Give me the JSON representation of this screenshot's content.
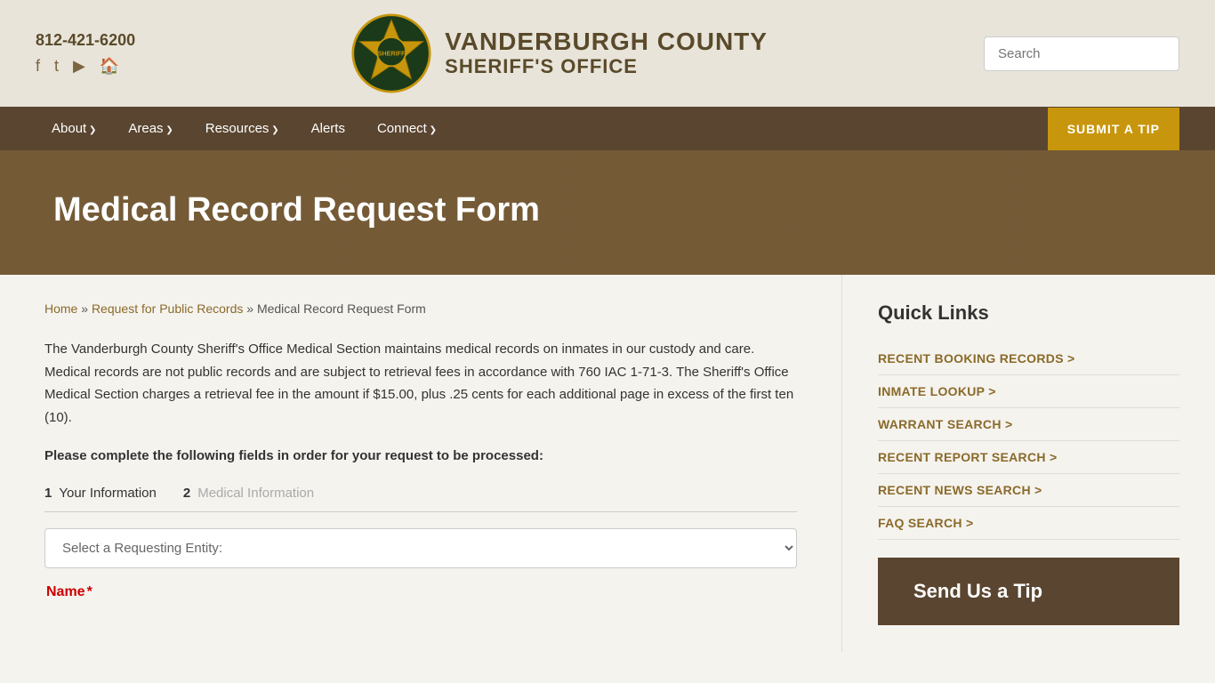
{
  "header": {
    "phone": "812-421-6200",
    "logo_title": "VANDERBURGH COUNTY",
    "logo_subtitle": "SHERIFF'S OFFICE",
    "search_placeholder": "Search"
  },
  "nav": {
    "items": [
      {
        "label": "About",
        "has_arrow": true
      },
      {
        "label": "Areas",
        "has_arrow": true
      },
      {
        "label": "Resources",
        "has_arrow": true
      },
      {
        "label": "Alerts",
        "has_arrow": false
      },
      {
        "label": "Connect",
        "has_arrow": true
      }
    ],
    "cta_label": "SUBMIT A TIP"
  },
  "hero": {
    "title": "Medical Record Request Form"
  },
  "breadcrumb": {
    "home": "Home",
    "separator1": " » ",
    "parent": "Request for Public Records",
    "separator2": " » ",
    "current": "Medical Record Request Form"
  },
  "content": {
    "body_text": "The Vanderburgh County Sheriff's Office Medical Section maintains medical records on inmates in our custody and care. Medical records are not public records and are subject to retrieval fees in accordance with 760 IAC 1-71-3. The Sheriff's Office Medical Section charges a retrieval fee in the amount if $15.00, plus .25 cents for each additional page in excess of the first ten (10).",
    "instruction": "Please complete the following fields in order for your request to be processed:"
  },
  "form": {
    "step1_num": "1",
    "step1_label": "Your Information",
    "step2_num": "2",
    "step2_label": "Medical Information",
    "select_placeholder": "Select a Requesting Entity:",
    "name_label": "Name",
    "name_required": "*"
  },
  "sidebar": {
    "quick_links_title": "Quick Links",
    "links": [
      {
        "label": "RECENT BOOKING Records >"
      },
      {
        "label": "INMATE Lookup >"
      },
      {
        "label": "WARRANT Search >"
      },
      {
        "label": "RECENT REPORT Search >"
      },
      {
        "label": "RECENT NEWS Search >"
      },
      {
        "label": "FAQ Search >"
      }
    ],
    "send_tip_title": "Send Us a Tip"
  },
  "social": {
    "facebook": "f",
    "twitter": "t",
    "youtube": "▶",
    "building": "🏠"
  }
}
